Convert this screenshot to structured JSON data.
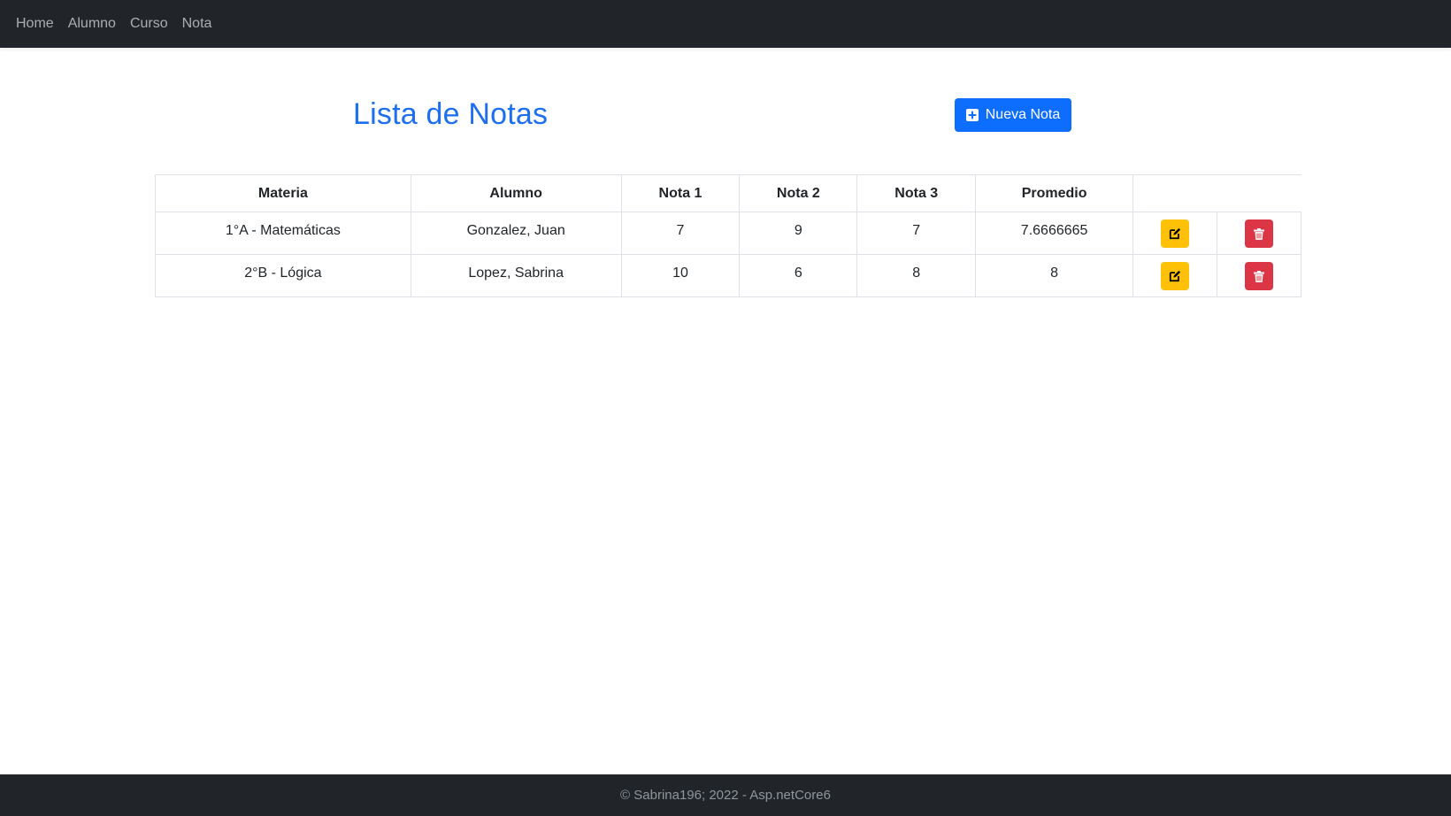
{
  "nav": {
    "items": [
      {
        "label": "Home"
      },
      {
        "label": "Alumno"
      },
      {
        "label": "Curso"
      },
      {
        "label": "Nota"
      }
    ]
  },
  "header": {
    "title": "Lista de Notas",
    "new_button_label": "Nueva Nota",
    "new_button_icon": "plus-square-icon"
  },
  "table": {
    "columns": [
      "Materia",
      "Alumno",
      "Nota 1",
      "Nota 2",
      "Nota 3",
      "Promedio",
      ""
    ],
    "rows": [
      {
        "materia": "1°A - Matemáticas",
        "alumno": "Gonzalez, Juan",
        "nota1": "7",
        "nota2": "9",
        "nota3": "7",
        "promedio": "7.6666665"
      },
      {
        "materia": "2°B - Lógica",
        "alumno": "Lopez, Sabrina",
        "nota1": "10",
        "nota2": "6",
        "nota3": "8",
        "promedio": "8"
      }
    ],
    "edit_icon": "edit-icon",
    "delete_icon": "trash-icon"
  },
  "colors": {
    "navbar": "#212529",
    "primary": "#0d6efd",
    "title": "#1d6ef0",
    "warning": "#ffc107",
    "danger": "#dc3545"
  },
  "footer": {
    "text": "© Sabrina196; 2022 - Asp.netCore6"
  }
}
